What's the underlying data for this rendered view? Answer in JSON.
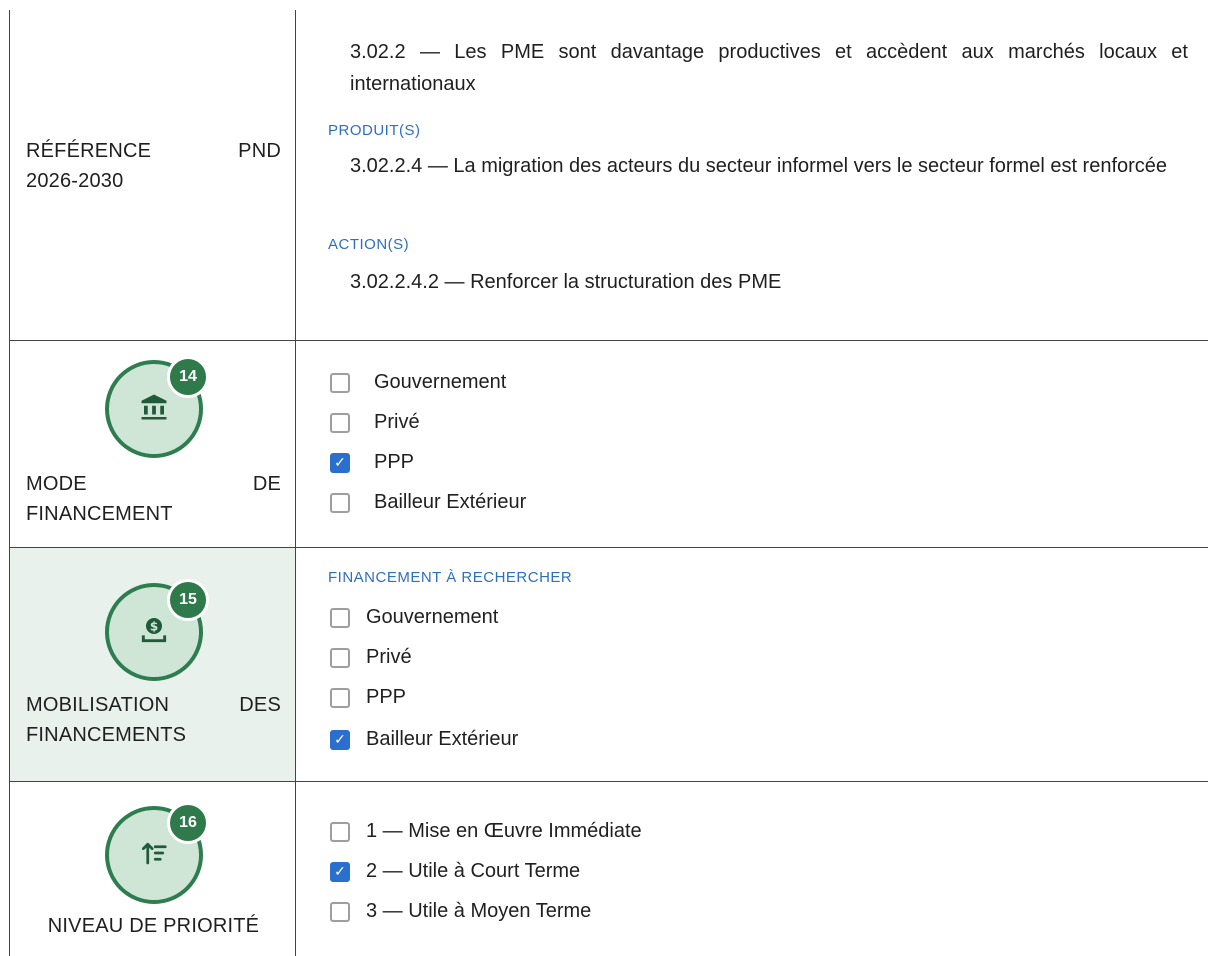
{
  "reference": {
    "label_line1_left": "RÉFÉRENCE",
    "label_line1_right": "PND",
    "label_line2": "2026-2030",
    "objective": "3.02.2 — Les PME sont davantage productives et accèdent aux marchés locaux et internationaux",
    "produits_heading": "PRODUIT(S)",
    "produit": "3.02.2.4 — La migration des acteurs du secteur informel vers le secteur formel est renforcée",
    "actions_heading": "ACTION(S)",
    "action": "3.02.2.4.2 — Renforcer la structuration des PME"
  },
  "mode_financement": {
    "badge": "14",
    "icon": "bank-icon",
    "label_line1_left": "MODE",
    "label_line1_right": "DE",
    "label_line2": "FINANCEMENT",
    "options": [
      {
        "label": "Gouvernement",
        "checked": false
      },
      {
        "label": "Privé",
        "checked": false
      },
      {
        "label": "PPP",
        "checked": true
      },
      {
        "label": "Bailleur Extérieur",
        "checked": false
      }
    ]
  },
  "mobilisation": {
    "badge": "15",
    "icon": "money-deposit-icon",
    "label_line1_left": "MOBILISATION",
    "label_line1_right": "DES",
    "label_line2": "FINANCEMENTS",
    "heading": "FINANCEMENT À RECHERCHER",
    "options": [
      {
        "label": "Gouvernement",
        "checked": false
      },
      {
        "label": "Privé",
        "checked": false
      },
      {
        "label": "PPP",
        "checked": false
      },
      {
        "label": "Bailleur Extérieur",
        "checked": true
      }
    ]
  },
  "priorite": {
    "badge": "16",
    "icon": "sort-priority-icon",
    "label": "NIVEAU DE PRIORITÉ",
    "options": [
      {
        "label": "1 — Mise en Œuvre Immédiate",
        "checked": false
      },
      {
        "label": "2 — Utile à Court Terme",
        "checked": true
      },
      {
        "label": "3 — Utile à Moyen Terme",
        "checked": false
      }
    ]
  },
  "colors": {
    "accent_green": "#2e7d4f",
    "circle_fill": "#cfe6d6",
    "heading_blue": "#2f6fc0",
    "checkbox_blue": "#2a6fce",
    "shaded_cell": "#e9f1ec"
  }
}
